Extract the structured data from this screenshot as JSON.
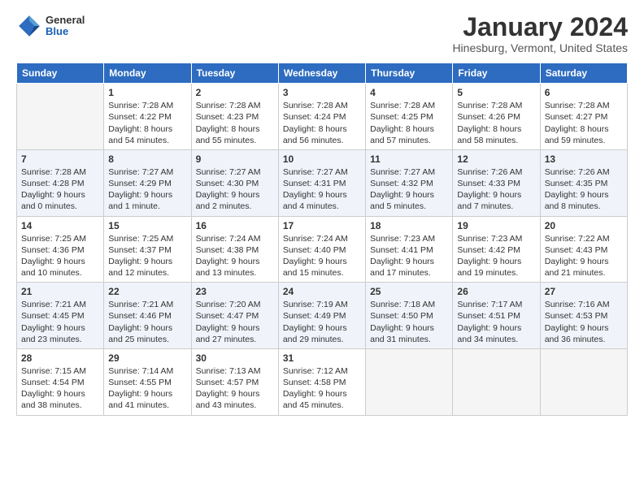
{
  "header": {
    "logo": {
      "general": "General",
      "blue": "Blue"
    },
    "month": "January 2024",
    "location": "Hinesburg, Vermont, United States"
  },
  "weekdays": [
    "Sunday",
    "Monday",
    "Tuesday",
    "Wednesday",
    "Thursday",
    "Friday",
    "Saturday"
  ],
  "weeks": [
    [
      {
        "day": null,
        "empty": true
      },
      {
        "day": "1",
        "sunrise": "7:28 AM",
        "sunset": "4:22 PM",
        "daylight": "8 hours and 54 minutes."
      },
      {
        "day": "2",
        "sunrise": "7:28 AM",
        "sunset": "4:23 PM",
        "daylight": "8 hours and 55 minutes."
      },
      {
        "day": "3",
        "sunrise": "7:28 AM",
        "sunset": "4:24 PM",
        "daylight": "8 hours and 56 minutes."
      },
      {
        "day": "4",
        "sunrise": "7:28 AM",
        "sunset": "4:25 PM",
        "daylight": "8 hours and 57 minutes."
      },
      {
        "day": "5",
        "sunrise": "7:28 AM",
        "sunset": "4:26 PM",
        "daylight": "8 hours and 58 minutes."
      },
      {
        "day": "6",
        "sunrise": "7:28 AM",
        "sunset": "4:27 PM",
        "daylight": "8 hours and 59 minutes."
      }
    ],
    [
      {
        "day": "7",
        "sunrise": "7:28 AM",
        "sunset": "4:28 PM",
        "daylight": "9 hours and 0 minutes."
      },
      {
        "day": "8",
        "sunrise": "7:27 AM",
        "sunset": "4:29 PM",
        "daylight": "9 hours and 1 minute."
      },
      {
        "day": "9",
        "sunrise": "7:27 AM",
        "sunset": "4:30 PM",
        "daylight": "9 hours and 2 minutes."
      },
      {
        "day": "10",
        "sunrise": "7:27 AM",
        "sunset": "4:31 PM",
        "daylight": "9 hours and 4 minutes."
      },
      {
        "day": "11",
        "sunrise": "7:27 AM",
        "sunset": "4:32 PM",
        "daylight": "9 hours and 5 minutes."
      },
      {
        "day": "12",
        "sunrise": "7:26 AM",
        "sunset": "4:33 PM",
        "daylight": "9 hours and 7 minutes."
      },
      {
        "day": "13",
        "sunrise": "7:26 AM",
        "sunset": "4:35 PM",
        "daylight": "9 hours and 8 minutes."
      }
    ],
    [
      {
        "day": "14",
        "sunrise": "7:25 AM",
        "sunset": "4:36 PM",
        "daylight": "9 hours and 10 minutes."
      },
      {
        "day": "15",
        "sunrise": "7:25 AM",
        "sunset": "4:37 PM",
        "daylight": "9 hours and 12 minutes."
      },
      {
        "day": "16",
        "sunrise": "7:24 AM",
        "sunset": "4:38 PM",
        "daylight": "9 hours and 13 minutes."
      },
      {
        "day": "17",
        "sunrise": "7:24 AM",
        "sunset": "4:40 PM",
        "daylight": "9 hours and 15 minutes."
      },
      {
        "day": "18",
        "sunrise": "7:23 AM",
        "sunset": "4:41 PM",
        "daylight": "9 hours and 17 minutes."
      },
      {
        "day": "19",
        "sunrise": "7:23 AM",
        "sunset": "4:42 PM",
        "daylight": "9 hours and 19 minutes."
      },
      {
        "day": "20",
        "sunrise": "7:22 AM",
        "sunset": "4:43 PM",
        "daylight": "9 hours and 21 minutes."
      }
    ],
    [
      {
        "day": "21",
        "sunrise": "7:21 AM",
        "sunset": "4:45 PM",
        "daylight": "9 hours and 23 minutes."
      },
      {
        "day": "22",
        "sunrise": "7:21 AM",
        "sunset": "4:46 PM",
        "daylight": "9 hours and 25 minutes."
      },
      {
        "day": "23",
        "sunrise": "7:20 AM",
        "sunset": "4:47 PM",
        "daylight": "9 hours and 27 minutes."
      },
      {
        "day": "24",
        "sunrise": "7:19 AM",
        "sunset": "4:49 PM",
        "daylight": "9 hours and 29 minutes."
      },
      {
        "day": "25",
        "sunrise": "7:18 AM",
        "sunset": "4:50 PM",
        "daylight": "9 hours and 31 minutes."
      },
      {
        "day": "26",
        "sunrise": "7:17 AM",
        "sunset": "4:51 PM",
        "daylight": "9 hours and 34 minutes."
      },
      {
        "day": "27",
        "sunrise": "7:16 AM",
        "sunset": "4:53 PM",
        "daylight": "9 hours and 36 minutes."
      }
    ],
    [
      {
        "day": "28",
        "sunrise": "7:15 AM",
        "sunset": "4:54 PM",
        "daylight": "9 hours and 38 minutes."
      },
      {
        "day": "29",
        "sunrise": "7:14 AM",
        "sunset": "4:55 PM",
        "daylight": "9 hours and 41 minutes."
      },
      {
        "day": "30",
        "sunrise": "7:13 AM",
        "sunset": "4:57 PM",
        "daylight": "9 hours and 43 minutes."
      },
      {
        "day": "31",
        "sunrise": "7:12 AM",
        "sunset": "4:58 PM",
        "daylight": "9 hours and 45 minutes."
      },
      {
        "day": null,
        "empty": true
      },
      {
        "day": null,
        "empty": true
      },
      {
        "day": null,
        "empty": true
      }
    ]
  ],
  "labels": {
    "sunrise": "Sunrise:",
    "sunset": "Sunset:",
    "daylight": "Daylight:"
  }
}
